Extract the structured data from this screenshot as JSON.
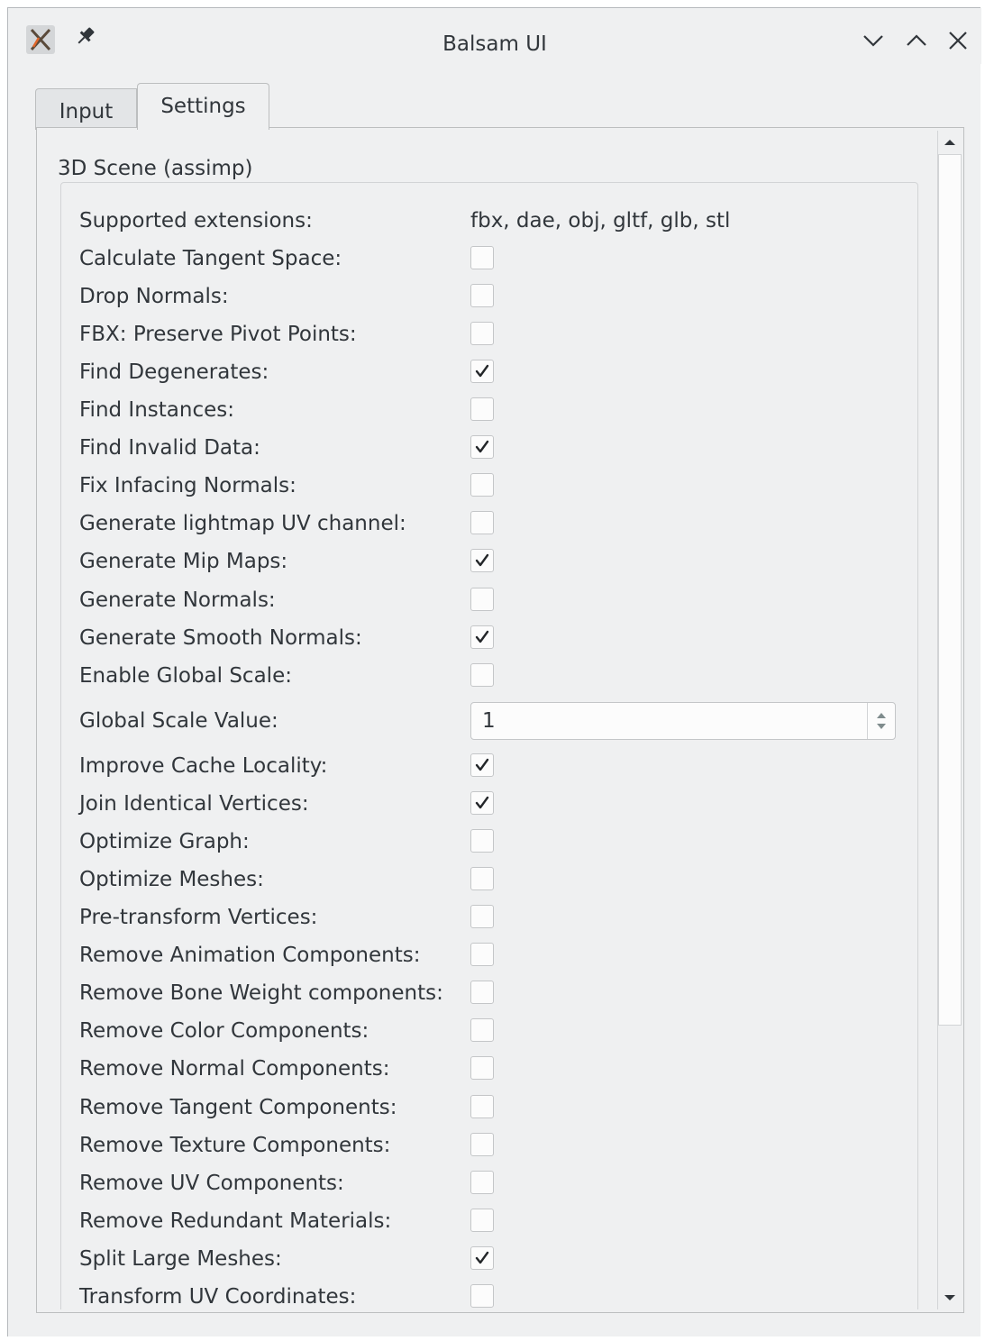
{
  "window": {
    "title": "Balsam UI",
    "icons": [
      "app-icon",
      "pin-icon",
      "minimize-icon",
      "maximize-icon",
      "close-icon"
    ]
  },
  "tabs": [
    {
      "label": "Input",
      "active": false
    },
    {
      "label": "Settings",
      "active": true
    }
  ],
  "group": {
    "title": "3D Scene (assimp)",
    "supported_extensions": {
      "label": "Supported extensions:",
      "value": "fbx, dae, obj, gltf, glb, stl"
    },
    "options": [
      {
        "label": "Calculate Tangent Space:",
        "checked": false
      },
      {
        "label": "Drop Normals:",
        "checked": false
      },
      {
        "label": "FBX: Preserve Pivot Points:",
        "checked": false
      },
      {
        "label": "Find Degenerates:",
        "checked": true
      },
      {
        "label": "Find Instances:",
        "checked": false
      },
      {
        "label": "Find Invalid Data:",
        "checked": true
      },
      {
        "label": "Fix Infacing Normals:",
        "checked": false
      },
      {
        "label": "Generate lightmap UV channel:",
        "checked": false
      },
      {
        "label": "Generate Mip Maps:",
        "checked": true
      },
      {
        "label": "Generate Normals:",
        "checked": false
      },
      {
        "label": "Generate Smooth Normals:",
        "checked": true
      },
      {
        "label": "Enable Global Scale:",
        "checked": false
      }
    ],
    "global_scale": {
      "label": "Global Scale Value:",
      "value": "1"
    },
    "options2": [
      {
        "label": "Improve Cache Locality:",
        "checked": true
      },
      {
        "label": "Join Identical Vertices:",
        "checked": true
      },
      {
        "label": "Optimize Graph:",
        "checked": false
      },
      {
        "label": "Optimize Meshes:",
        "checked": false
      },
      {
        "label": "Pre-transform Vertices:",
        "checked": false
      },
      {
        "label": "Remove Animation Components:",
        "checked": false
      },
      {
        "label": "Remove Bone Weight components:",
        "checked": false
      },
      {
        "label": "Remove Color Components:",
        "checked": false
      },
      {
        "label": "Remove Normal Components:",
        "checked": false
      },
      {
        "label": "Remove Tangent Components:",
        "checked": false
      },
      {
        "label": "Remove Texture Components:",
        "checked": false
      },
      {
        "label": "Remove UV Components:",
        "checked": false
      },
      {
        "label": "Remove Redundant Materials:",
        "checked": false
      },
      {
        "label": "Split Large Meshes:",
        "checked": true
      },
      {
        "label": "Transform UV Coordinates:",
        "checked": false
      }
    ]
  },
  "scrollbar": {
    "position_fraction": 0.0,
    "visible_fraction": 0.77
  }
}
